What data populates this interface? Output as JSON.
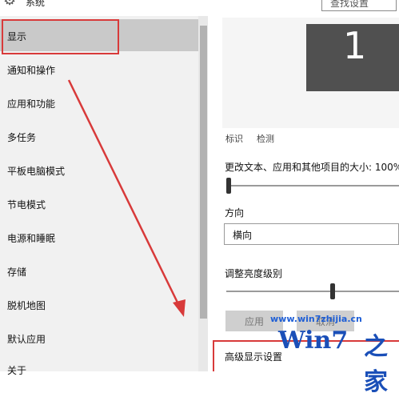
{
  "header": {
    "app_title": "系统",
    "search_placeholder": "查找设置"
  },
  "sidebar": {
    "items": [
      {
        "label": "显示",
        "active": true
      },
      {
        "label": "通知和操作"
      },
      {
        "label": "应用和功能"
      },
      {
        "label": "多任务"
      },
      {
        "label": "平板电脑模式"
      },
      {
        "label": "节电模式"
      },
      {
        "label": "电源和睡眠"
      },
      {
        "label": "存储"
      },
      {
        "label": "脱机地图"
      },
      {
        "label": "默认应用"
      },
      {
        "label": "关于"
      }
    ]
  },
  "display": {
    "monitor_number": "1",
    "identify_link": "标识",
    "detect_link": "检测",
    "scale_label": "更改文本、应用和其他项目的大小: 100%",
    "scale_value": 0,
    "orientation_label": "方向",
    "orientation_value": "横向",
    "brightness_label": "调整亮度级别",
    "brightness_value": 0.62,
    "apply_button": "应用",
    "cancel_button": "取消",
    "advanced_link": "高级显示设置"
  },
  "watermark": {
    "url": "www.win7zhijia.cn",
    "logo_text": "Win7",
    "logo_suffix": "之家"
  },
  "colors": {
    "highlight_red": "#d83a3a",
    "sidebar_bg": "#f1f1f1",
    "active_bg": "#c9c9c9",
    "monitor_bg": "#505050"
  }
}
